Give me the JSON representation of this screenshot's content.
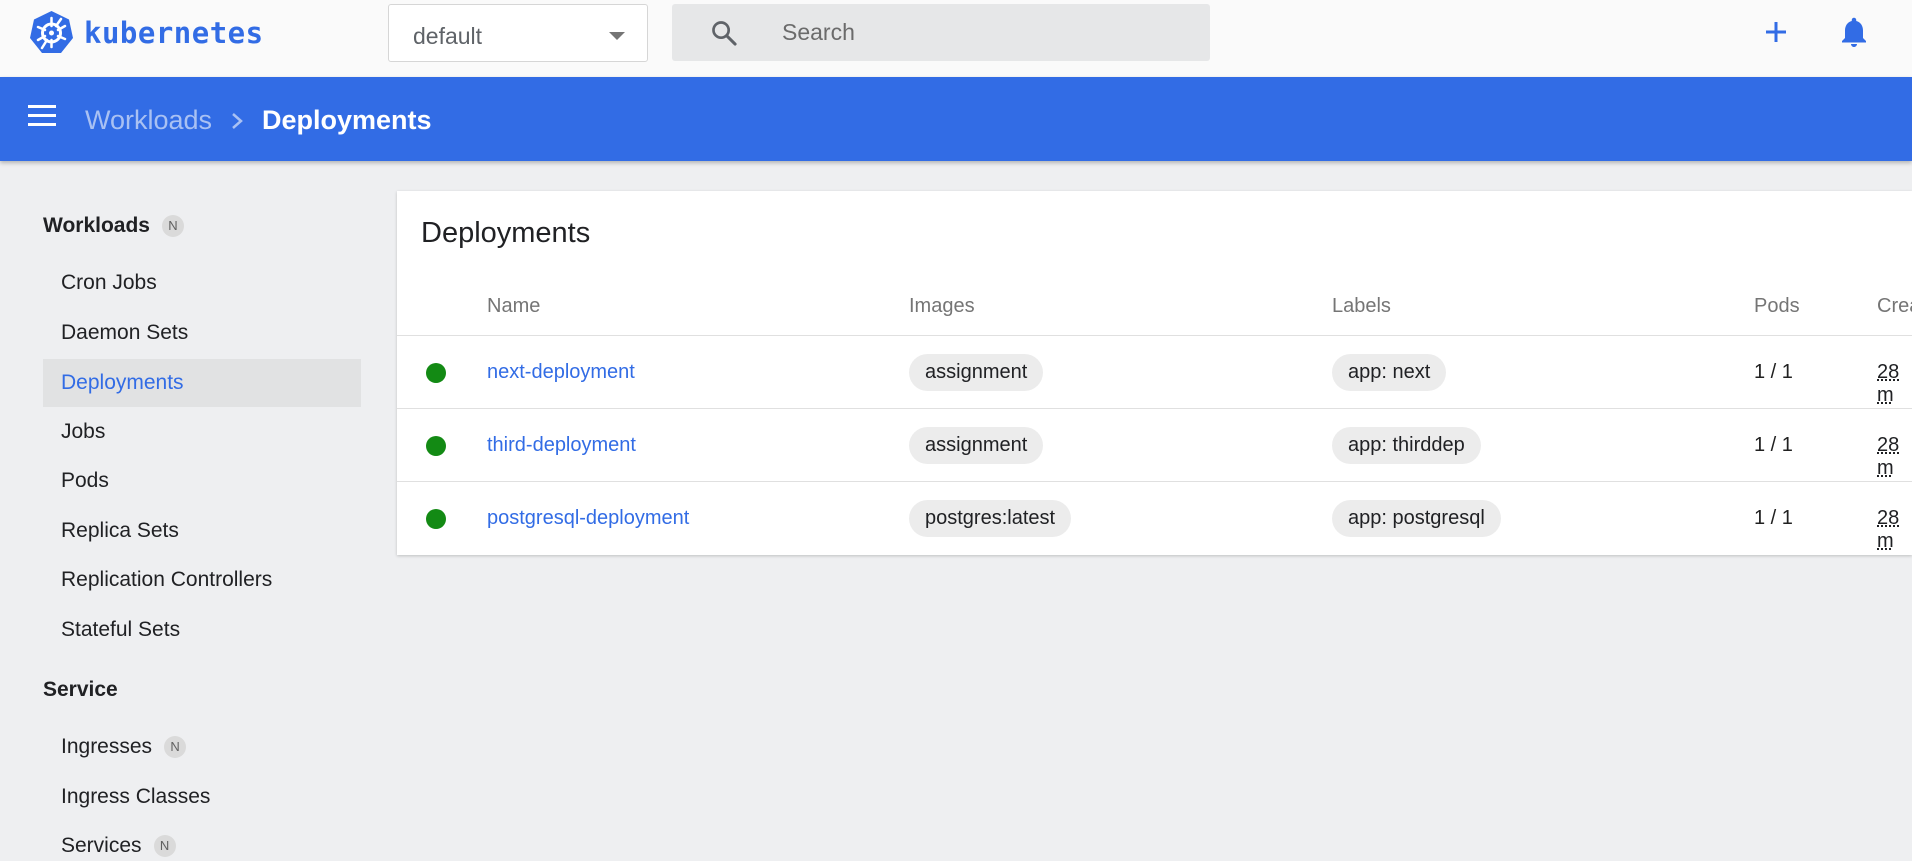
{
  "topbar": {
    "logo_text": "kubernetes",
    "namespace": "default",
    "search_placeholder": "Search"
  },
  "header": {
    "breadcrumb_parent": "Workloads",
    "breadcrumb_current": "Deployments"
  },
  "sidebar": {
    "badge": "N",
    "workloads": {
      "title": "Workloads",
      "items": [
        "Cron Jobs",
        "Daemon Sets",
        "Deployments",
        "Jobs",
        "Pods",
        "Replica Sets",
        "Replication Controllers",
        "Stateful Sets"
      ],
      "active": "Deployments"
    },
    "service": {
      "title": "Service",
      "items": [
        "Ingresses",
        "Ingress Classes",
        "Services"
      ]
    }
  },
  "deployments": {
    "title": "Deployments",
    "columns": [
      "Name",
      "Images",
      "Labels",
      "Pods",
      "Crea"
    ],
    "rows": [
      {
        "name": "next-deployment",
        "image": "assignment",
        "label": "app: next",
        "pods": "1 / 1",
        "created": "28 m",
        "status": "running"
      },
      {
        "name": "third-deployment",
        "image": "assignment",
        "label": "app: thirddep",
        "pods": "1 / 1",
        "created": "28 m",
        "status": "running"
      },
      {
        "name": "postgresql-deployment",
        "image": "postgres:latest",
        "label": "app: postgresql",
        "pods": "1 / 1",
        "created": "28 m",
        "status": "running"
      }
    ]
  },
  "colors": {
    "brand": "#326ce5",
    "status_ok": "#138a14"
  }
}
